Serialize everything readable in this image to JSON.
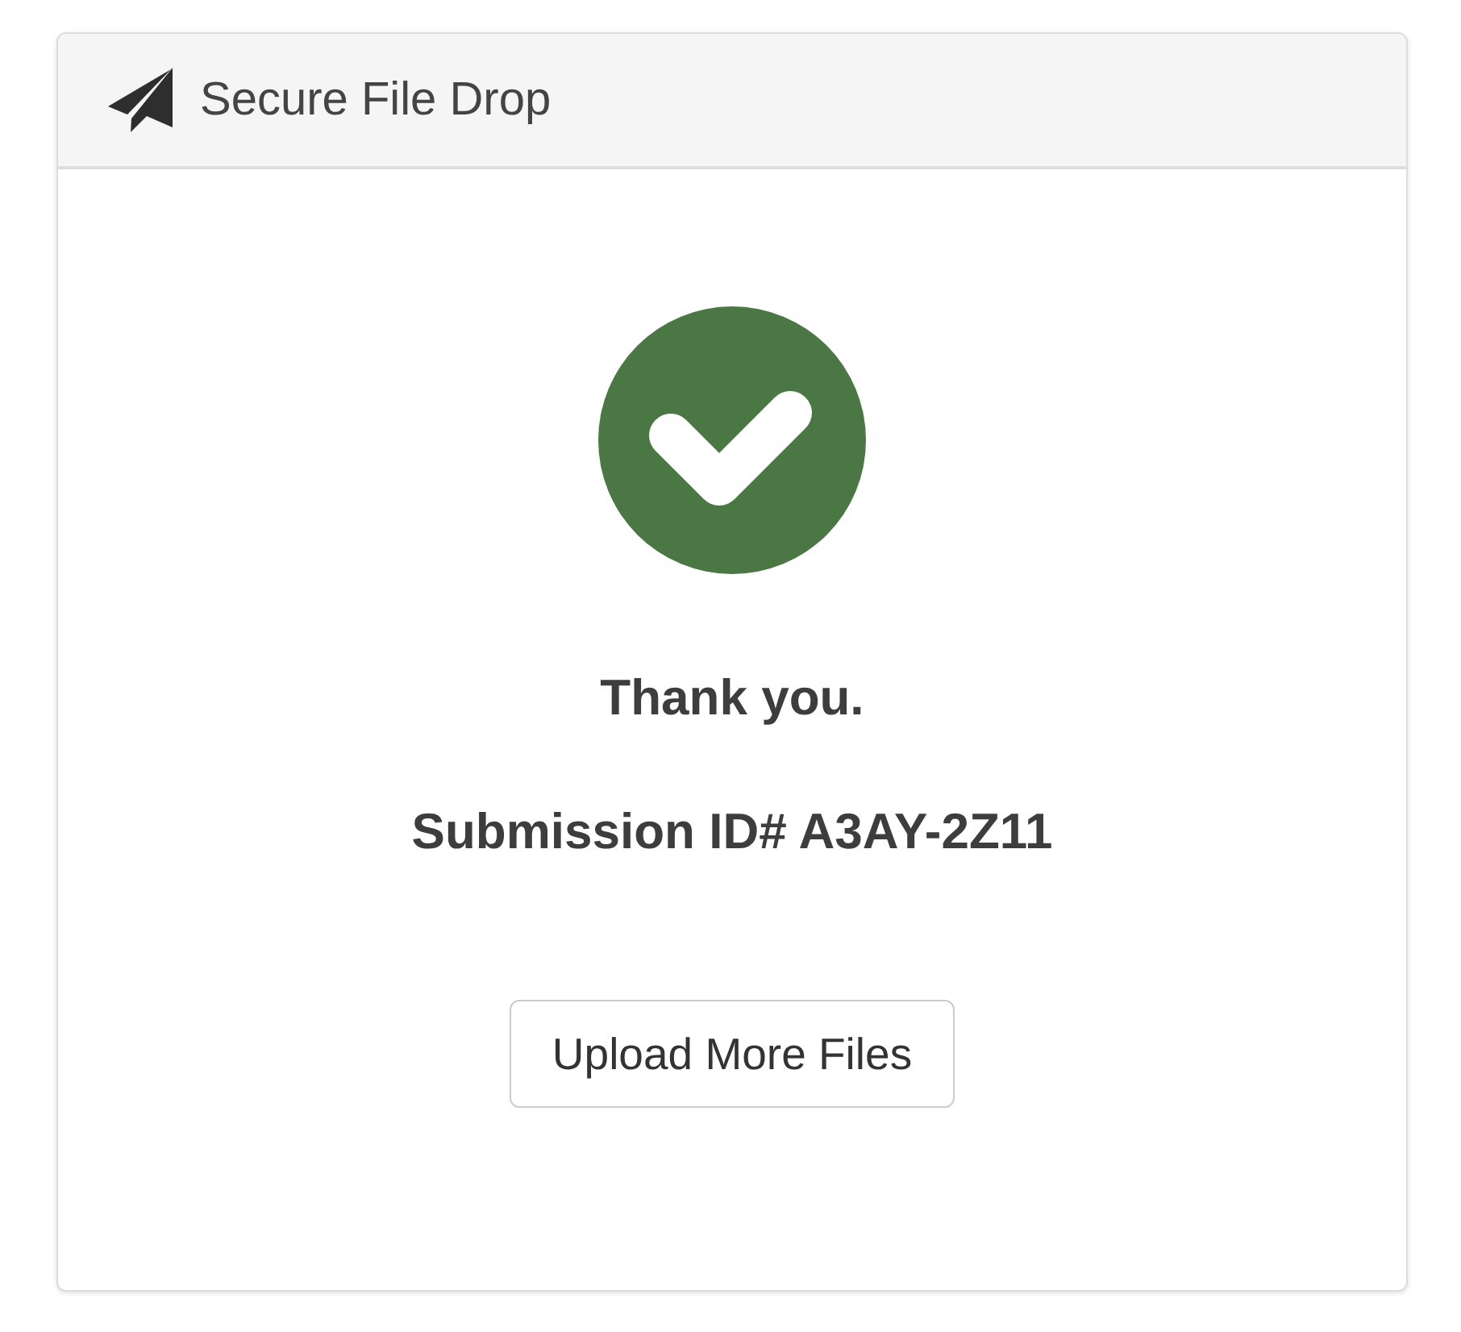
{
  "header": {
    "title": "Secure File Drop"
  },
  "confirmation": {
    "success": true,
    "message": "Thank you.",
    "submission_id": "Submission ID# A3AY-2Z11"
  },
  "buttons": [
    {
      "label": "Upload More Files"
    }
  ]
}
